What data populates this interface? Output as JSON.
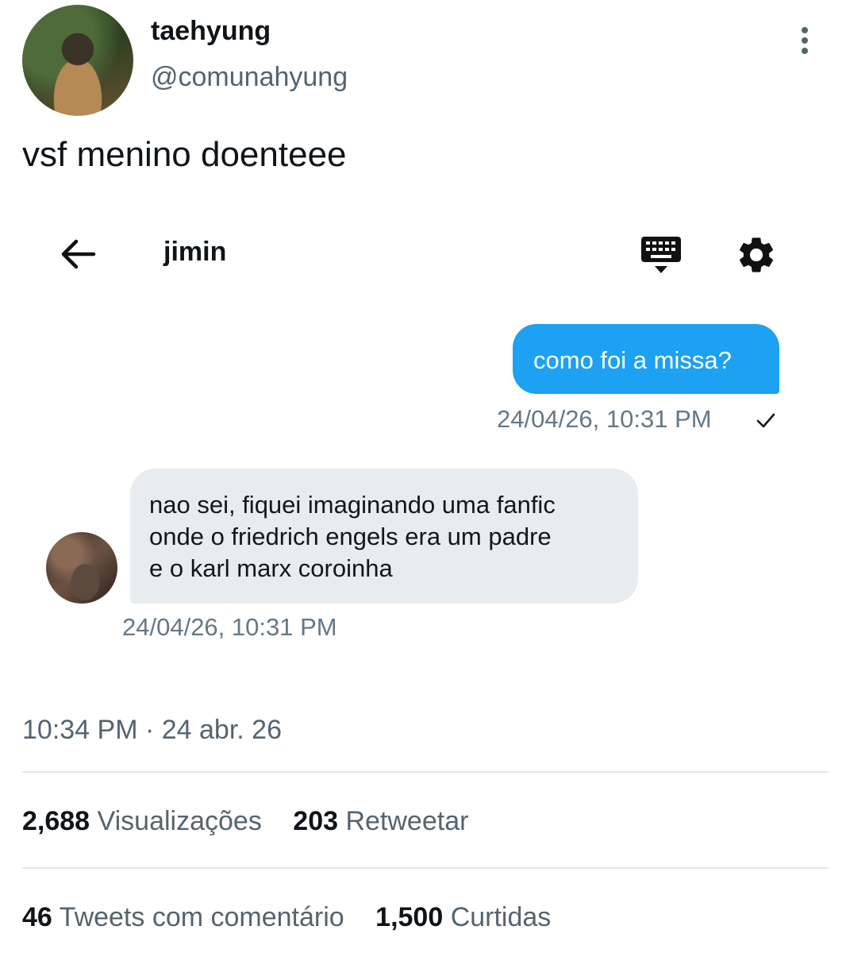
{
  "tweet": {
    "display_name": "taehyung",
    "handle": "@comunahyung",
    "text": "vsf menino doenteee",
    "time": "10:34 PM · 24 abr. 26"
  },
  "dm": {
    "contact_name": "jimin",
    "messages": [
      {
        "direction": "outgoing",
        "text": "como foi a missa?",
        "timestamp": "24/04/26, 10:31 PM"
      },
      {
        "direction": "incoming",
        "lines": [
          "nao sei, fiquei imaginando uma fanfic",
          "onde o friedrich engels era um padre",
          "e o karl marx coroinha"
        ],
        "timestamp": "24/04/26, 10:31 PM"
      }
    ]
  },
  "stats": {
    "views": {
      "value": "2,688",
      "label": "Visualizações"
    },
    "retweets": {
      "value": "203",
      "label": "Retweetar"
    },
    "quotes": {
      "value": "46",
      "label": "Tweets com comentário"
    },
    "likes": {
      "value": "1,500",
      "label": "Curtidas"
    }
  },
  "colors": {
    "outgoing_bubble": "#1da1f2",
    "incoming_bubble": "#e6ecf0",
    "secondary_text": "#536471"
  },
  "icons": [
    "more-vertical-icon",
    "back-arrow-icon",
    "keyboard-icon",
    "gear-icon",
    "check-icon"
  ]
}
